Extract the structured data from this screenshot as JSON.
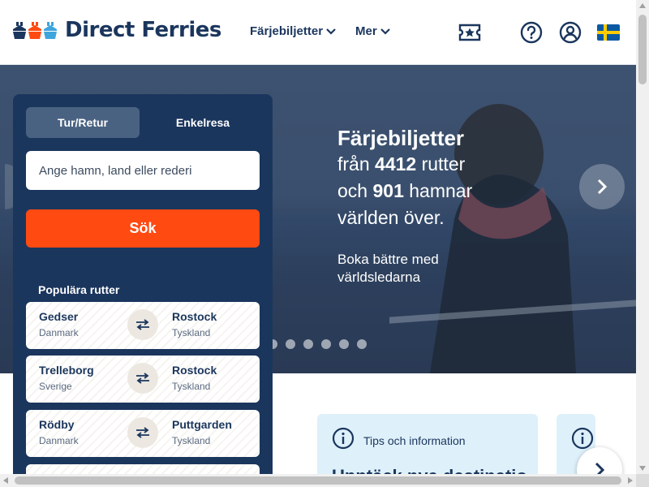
{
  "header": {
    "brand": "Direct Ferries",
    "nav": [
      {
        "label": "Färjebiljetter"
      },
      {
        "label": "Mer"
      }
    ],
    "icons": [
      "ticket-icon",
      "help-icon",
      "account-icon",
      "swedish-flag-icon"
    ]
  },
  "hero": {
    "title": "Färjebiljetter",
    "line1_prefix": "från ",
    "routes_count": "4412",
    "line1_suffix": " rutter",
    "line2_prefix": "och ",
    "ports_count": "901",
    "line2_suffix": " hamnar",
    "line3": "världen över.",
    "subtitle": "Boka bättre med världsledarna",
    "dots": 6
  },
  "search": {
    "tabs": [
      {
        "label": "Tur/Retur",
        "active": true
      },
      {
        "label": "Enkelresa",
        "active": false
      }
    ],
    "placeholder": "Ange hamn, land eller rederi",
    "button_label": "Sök",
    "popular_title": "Populära rutter",
    "routes": [
      {
        "from_city": "Gedser",
        "from_country": "Danmark",
        "to_city": "Rostock",
        "to_country": "Tyskland"
      },
      {
        "from_city": "Trelleborg",
        "from_country": "Sverige",
        "to_city": "Rostock",
        "to_country": "Tyskland"
      },
      {
        "from_city": "Rödby",
        "from_country": "Danmark",
        "to_city": "Puttgarden",
        "to_country": "Tyskland"
      }
    ]
  },
  "info": {
    "card_title": "Tips och information",
    "card_heading": "Upptäck nya destinationer"
  },
  "colors": {
    "brand_navy": "#1b365d",
    "search_orange": "#ff4a12",
    "info_card": "#def0fa"
  }
}
